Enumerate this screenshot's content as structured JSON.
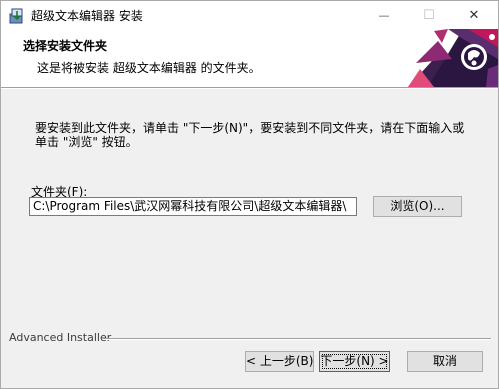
{
  "window": {
    "title": "超级文本编辑器 安装",
    "controls": {
      "minimize": "—",
      "maximize": "☐",
      "close": "✕"
    }
  },
  "header": {
    "title": "选择安装文件夹",
    "subtitle": "这是将被安装 超级文本编辑器 的文件夹。"
  },
  "main": {
    "instruction": "要安装到此文件夹，请单击 \"下一步(N)\"，要安装到不同文件夹，请在下面输入或单击 \"浏览\" 按钮。",
    "folder_label": "文件夹(F):",
    "folder_value": "C:\\Program Files\\武汉网幂科技有限公司\\超级文本编辑器\\",
    "browse_label": "浏览(O)..."
  },
  "footer": {
    "brand": "Advanced Installer",
    "back_label": "< 上一步(B)",
    "next_label": "下一步(N) >",
    "cancel_label": "取消"
  },
  "colors": {
    "banner_art_dark": "#3b1f4f",
    "banner_art_accent": "#c2185b",
    "default_button_border": "#0078d7"
  }
}
